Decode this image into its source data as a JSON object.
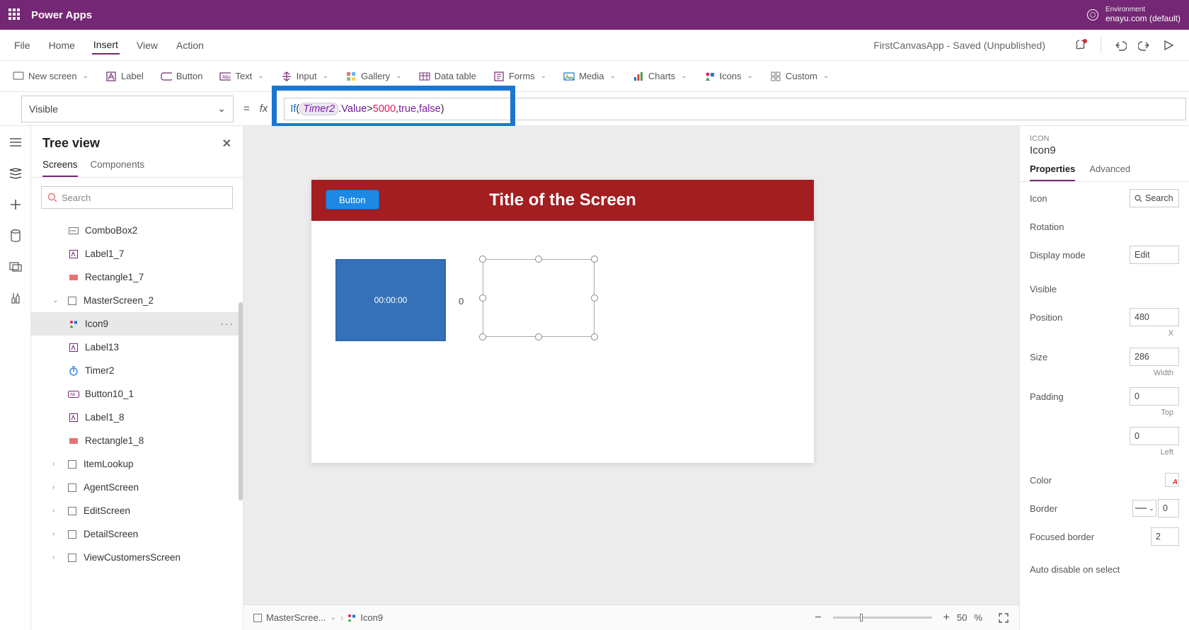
{
  "app": {
    "name": "Power Apps"
  },
  "environment": {
    "label": "Environment",
    "value": "enayu.com (default)"
  },
  "menu": {
    "file": "File",
    "home": "Home",
    "insert": "Insert",
    "view": "View",
    "action": "Action"
  },
  "status": "FirstCanvasApp - Saved (Unpublished)",
  "ribbon": {
    "newscreen": "New screen",
    "label": "Label",
    "button": "Button",
    "text": "Text",
    "input": "Input",
    "gallery": "Gallery",
    "datatable": "Data table",
    "forms": "Forms",
    "media": "Media",
    "charts": "Charts",
    "icons": "Icons",
    "custom": "Custom"
  },
  "formula": {
    "property": "Visible",
    "raw": "If(Timer2.Value > 5000, true, false)",
    "parts": {
      "kw": "If",
      "lp": "(",
      "var": "Timer2",
      "dot": ".",
      "prop": "Value",
      "op": " > ",
      "num": "5000",
      "c1": ", ",
      "t": "true",
      "c2": ", ",
      "f": "false",
      "rp": ")"
    }
  },
  "treeview": {
    "title": "Tree view",
    "tabs": {
      "screens": "Screens",
      "components": "Components"
    },
    "search_placeholder": "Search",
    "nodes": {
      "combobox2": "ComboBox2",
      "label1_7": "Label1_7",
      "rectangle1_7": "Rectangle1_7",
      "masterscreen": "MasterScreen_2",
      "icon9": "Icon9",
      "label13": "Label13",
      "timer2": "Timer2",
      "button10_1": "Button10_1",
      "label1_8": "Label1_8",
      "rectangle1_8": "Rectangle1_8",
      "itemlookup": "ItemLookup",
      "agentscreen": "AgentScreen",
      "editscreen": "EditScreen",
      "detailscreen": "DetailScreen",
      "viewcustomers": "ViewCustomersScreen"
    }
  },
  "canvas": {
    "title": "Title of the Screen",
    "button": "Button",
    "timer": "00:00:00",
    "label0": "0"
  },
  "breadcrumb": {
    "screen": "MasterScree...",
    "control": "Icon9"
  },
  "zoom": {
    "pct": "50",
    "unit": "%"
  },
  "props": {
    "section": "ICON",
    "name": "Icon9",
    "tabs": {
      "properties": "Properties",
      "advanced": "Advanced"
    },
    "rows": {
      "icon": "Icon",
      "iconval": "Search",
      "rotation": "Rotation",
      "displaymode": "Display mode",
      "displaymodeval": "Edit",
      "visible": "Visible",
      "position": "Position",
      "posx": "480",
      "posxl": "X",
      "size": "Size",
      "sizew": "286",
      "sizewl": "Width",
      "padding": "Padding",
      "padt": "0",
      "padtl": "Top",
      "padl": "0",
      "padll": "Left",
      "color": "Color",
      "border": "Border",
      "borderval": "0",
      "focusedborder": "Focused border",
      "focusedborderval": "2",
      "autodisable": "Auto disable on select"
    }
  }
}
